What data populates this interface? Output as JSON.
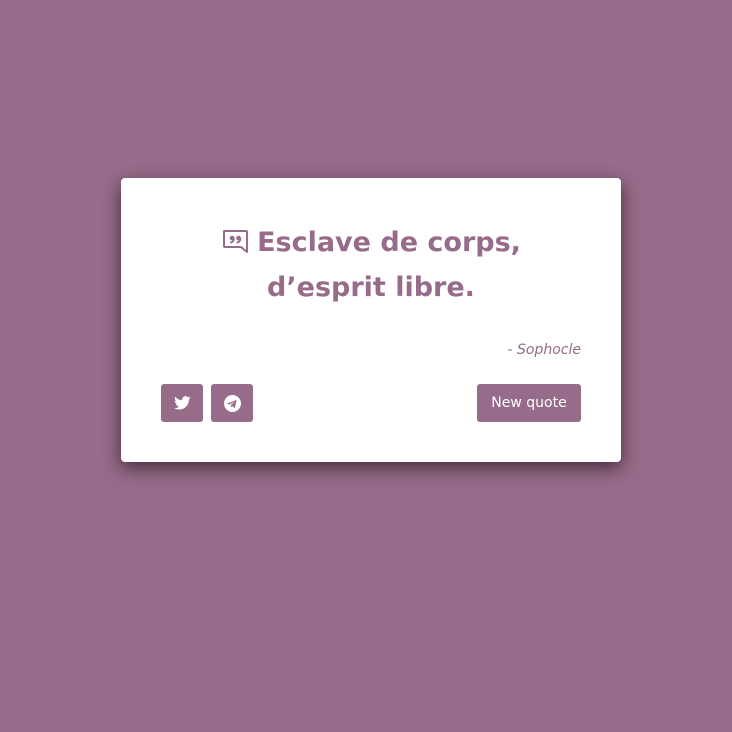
{
  "colors": {
    "background": "#976c8a",
    "card": "#ffffff",
    "accent": "#976c8a",
    "button_text": "#ffffff"
  },
  "quote": {
    "icon": "quote-icon",
    "text": "Esclave de corps, d’esprit libre.",
    "author": "- Sophocle"
  },
  "actions": {
    "twitter_icon": "twitter-icon",
    "telegram_icon": "telegram-icon",
    "new_quote_label": "New quote"
  }
}
